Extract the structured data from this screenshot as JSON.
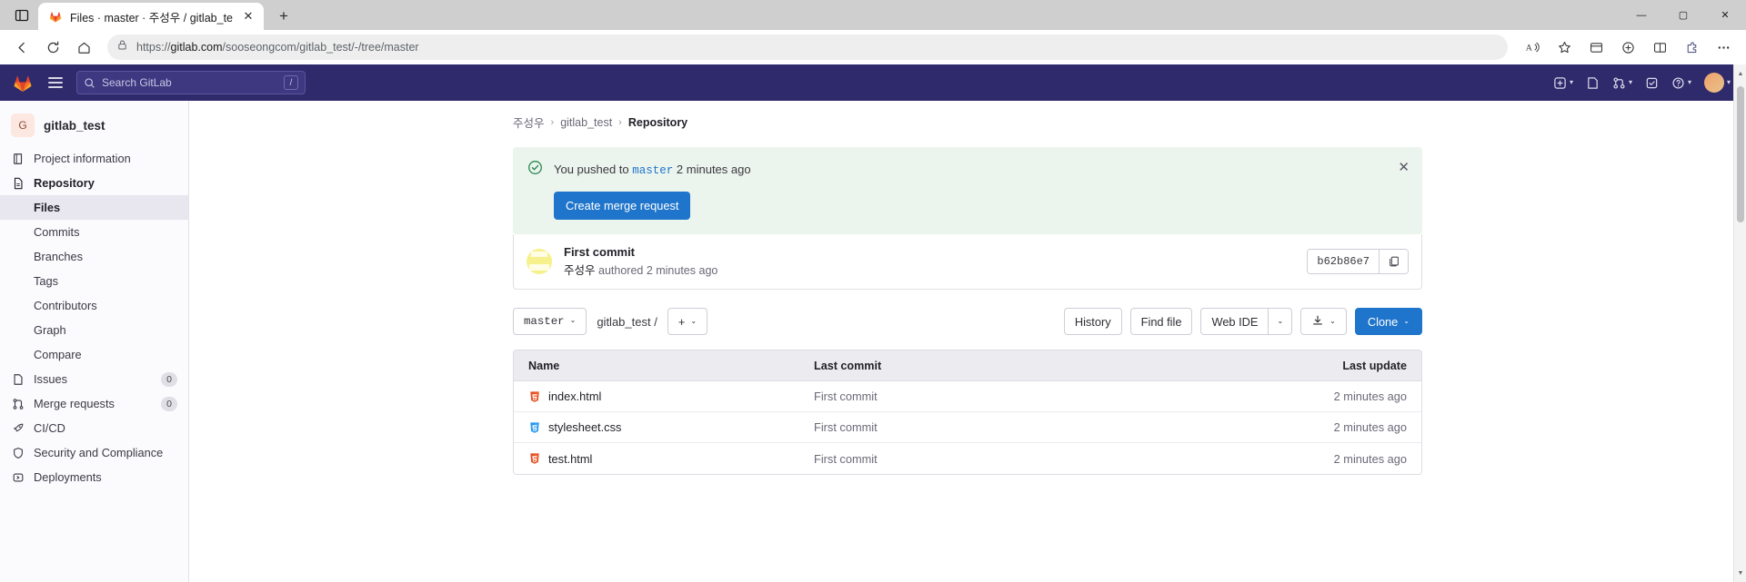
{
  "browser": {
    "tab": {
      "title": "Files · master · 주성우 / gitlab_te",
      "favicon": "gitlab-favicon",
      "close": "✕"
    },
    "newtab_label": "+",
    "window_controls": {
      "minimize": "—",
      "maximize": "▢",
      "close": "✕"
    },
    "nav": {
      "back": "←",
      "forward": "→",
      "reload": "⟳",
      "home": "⌂"
    },
    "address": {
      "lock": "lock-icon",
      "scheme": "https://",
      "host": "gitlab.com",
      "path": "/sooseongcom/gitlab_test/-/tree/master"
    },
    "toolbar_right": [
      "read-aloud-icon",
      "favorite-icon",
      "collections-icon",
      "browser-essentials-icon",
      "split-screen-icon",
      "copilot-icon",
      "settings-more-icon"
    ]
  },
  "topnav": {
    "logo": "gitlab-logo",
    "menu": "hamburger-icon",
    "search_placeholder": "Search GitLab",
    "search_shortcut": "/",
    "items": [
      "create-new-icon",
      "issues-icon",
      "merge-requests-icon",
      "todos-icon",
      "help-icon",
      "user-avatar"
    ]
  },
  "sidebar": {
    "project": {
      "initial": "G",
      "name": "gitlab_test"
    },
    "items": [
      {
        "label": "Project information",
        "icon": "book-icon",
        "bold": false
      },
      {
        "label": "Repository",
        "icon": "document-icon",
        "bold": true
      }
    ],
    "repo_children": [
      {
        "label": "Files",
        "active": true
      },
      {
        "label": "Commits",
        "active": false
      },
      {
        "label": "Branches",
        "active": false
      },
      {
        "label": "Tags",
        "active": false
      },
      {
        "label": "Contributors",
        "active": false
      },
      {
        "label": "Graph",
        "active": false
      },
      {
        "label": "Compare",
        "active": false
      }
    ],
    "bottom_items": [
      {
        "label": "Issues",
        "icon": "issues-icon",
        "badge": "0"
      },
      {
        "label": "Merge requests",
        "icon": "merge-request-icon",
        "badge": "0"
      },
      {
        "label": "CI/CD",
        "icon": "rocket-icon",
        "badge": ""
      },
      {
        "label": "Security and Compliance",
        "icon": "shield-icon",
        "badge": ""
      },
      {
        "label": "Deployments",
        "icon": "deployments-icon",
        "badge": ""
      }
    ]
  },
  "breadcrumb": {
    "owner": "주성우",
    "project": "gitlab_test",
    "section": "Repository",
    "separator": "›"
  },
  "alert": {
    "icon": "check-circle-icon",
    "prefix": "You pushed to",
    "branch": "master",
    "suffix": "2 minutes ago",
    "close": "✕",
    "button_label": "Create merge request"
  },
  "commit": {
    "title": "First commit",
    "author": "주성우",
    "authored_text": "authored 2 minutes ago",
    "sha": "b62b86e7",
    "copy_icon": "copy-icon"
  },
  "toolbar": {
    "branch": "master",
    "path": "gitlab_test",
    "path_sep": "/",
    "add_label": "+",
    "history": "History",
    "find_file": "Find file",
    "web_ide": "Web IDE",
    "download_icon": "download-icon",
    "clone": "Clone",
    "caret": "⌄"
  },
  "filetable": {
    "headers": {
      "name": "Name",
      "commit": "Last commit",
      "update": "Last update"
    },
    "rows": [
      {
        "name": "index.html",
        "icon": "html5-icon",
        "commit": "First commit",
        "update": "2 minutes ago"
      },
      {
        "name": "stylesheet.css",
        "icon": "css3-icon",
        "commit": "First commit",
        "update": "2 minutes ago"
      },
      {
        "name": "test.html",
        "icon": "html5-icon",
        "commit": "First commit",
        "update": "2 minutes ago"
      }
    ]
  },
  "colors": {
    "gitlab_navy": "#2f2a6b",
    "primary_blue": "#1f75cb",
    "alert_green_bg": "#ecf4ee",
    "html_orange": "#e44d26",
    "css_blue": "#2196f3"
  }
}
